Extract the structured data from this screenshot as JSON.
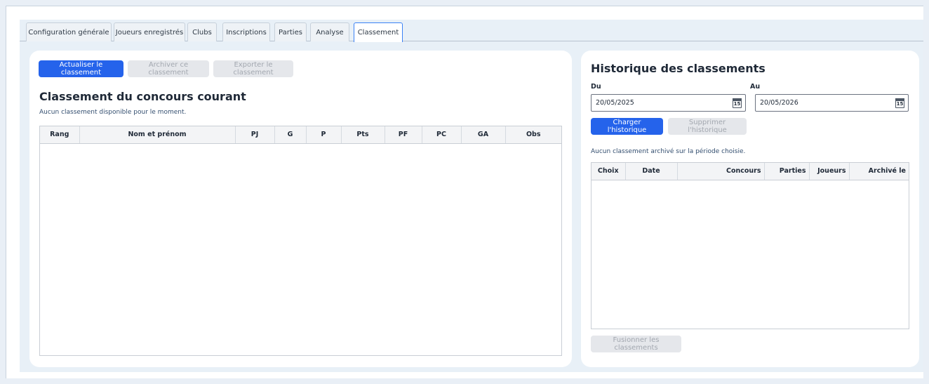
{
  "tabs": [
    {
      "label": "Configuration générale"
    },
    {
      "label": "Joueurs enregistrés"
    },
    {
      "label": "Clubs"
    },
    {
      "label": "Inscriptions"
    },
    {
      "label": "Parties"
    },
    {
      "label": "Analyse"
    },
    {
      "label": "Classement"
    }
  ],
  "active_tab": "Classement",
  "left": {
    "buttons": {
      "refresh": "Actualiser le classement",
      "archive": "Archiver ce classement",
      "export": "Exporter le classement"
    },
    "title": "Classement du concours courant",
    "subtitle": "Aucun classement disponible pour le moment.",
    "columns": [
      "Rang",
      "Nom et prénom",
      "PJ",
      "G",
      "P",
      "Pts",
      "PF",
      "PC",
      "GA",
      "Obs"
    ]
  },
  "right": {
    "title": "Historique des classements",
    "from_label": "Du",
    "to_label": "Au",
    "from_value": "20/05/2025",
    "to_value": "20/05/2026",
    "calendar_icon_text": "15",
    "buttons": {
      "load": "Charger l'historique",
      "delete": "Supprimer l'historique",
      "merge": "Fusionner les classements"
    },
    "message": "Aucun classement archivé sur la période choisie.",
    "columns": [
      "Choix",
      "Date",
      "Concours",
      "Parties",
      "Joueurs",
      "Archivé le"
    ]
  },
  "colors": {
    "primary": "#2563eb",
    "disabled_bg": "#e5e7eb",
    "panel_bg": "#e8f0f7"
  }
}
